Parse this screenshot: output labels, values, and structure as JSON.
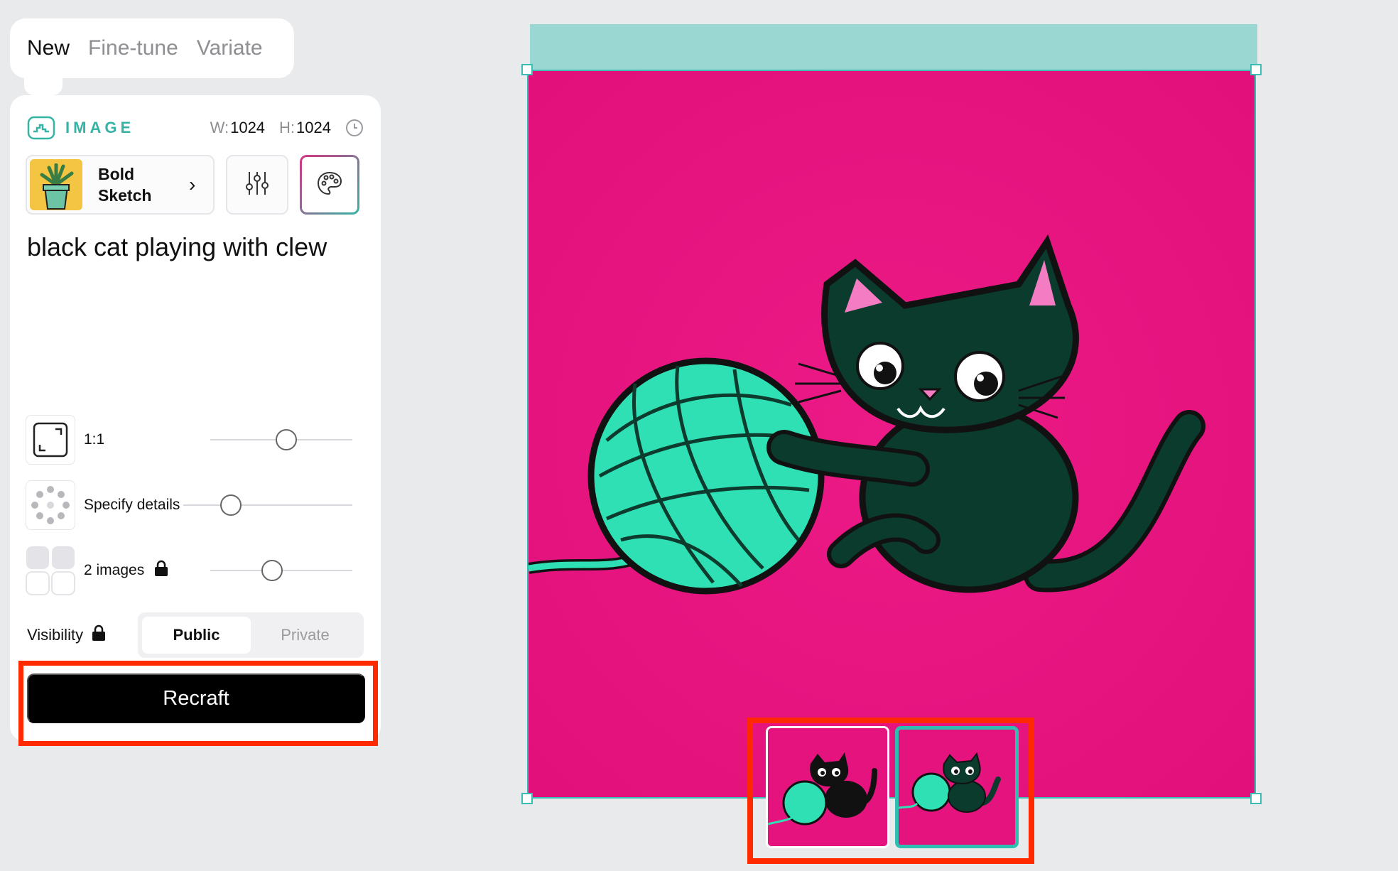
{
  "mode_tabs": [
    {
      "label": "New",
      "active": true
    },
    {
      "label": "Fine-tune",
      "active": false
    },
    {
      "label": "Variate",
      "active": false
    }
  ],
  "panel": {
    "type_label": "IMAGE",
    "type_icon": "image-icon",
    "width_key": "W:",
    "width_value": "1024",
    "height_key": "H:",
    "height_value": "1024",
    "history_icon": "clock-icon",
    "style": {
      "name_line1": "Bold",
      "name_line2": "Sketch",
      "icon": "plant-icon"
    },
    "settings_icon": "sliders-icon",
    "palette_icon": "palette-icon",
    "prompt": "black cat playing with clew",
    "controls": [
      {
        "label": "1:1",
        "icon": "aspect-ratio-icon",
        "slider": 0.48
      },
      {
        "label": "Specify details",
        "icon": "details-icon",
        "slider": 0.0
      },
      {
        "label": "2 images",
        "icon": "images-grid-icon",
        "locked": true,
        "slider": 0.36
      }
    ],
    "visibility": {
      "label": "Visibility",
      "locked": true,
      "options": [
        "Public",
        "Private"
      ],
      "selected": "Public"
    },
    "action_button": "Recraft"
  },
  "canvas": {
    "header_color": "#9ad7d2",
    "background_color": "#e4137e",
    "thumbnails": [
      {
        "selected": false
      },
      {
        "selected": true
      }
    ]
  },
  "colors": {
    "accent": "#35b3a5",
    "highlight": "#ff2a00",
    "canvas_pink": "#e4137e",
    "yarn": "#2fe0b4"
  }
}
